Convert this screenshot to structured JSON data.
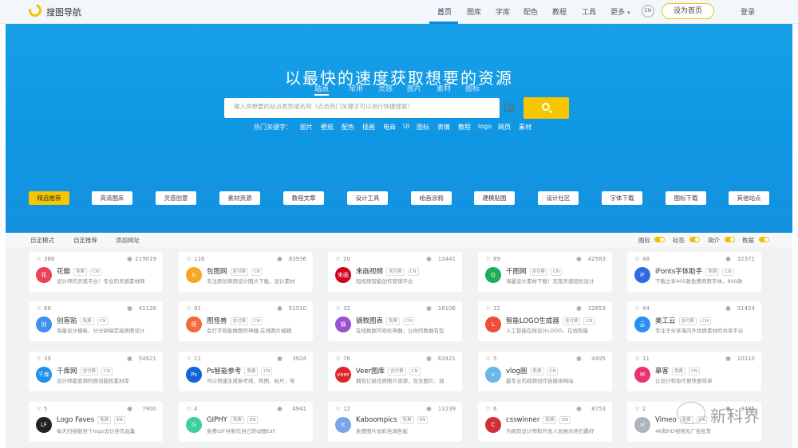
{
  "nav": {
    "logo": "搜图导航",
    "items": [
      "首页",
      "图库",
      "字库",
      "配色",
      "教程",
      "工具",
      "更多"
    ],
    "lang": "EN",
    "set_home": "设为首页",
    "login": "登录"
  },
  "hero": {
    "title": "以最快的速度获取想要的资源",
    "search_tabs": [
      "站点",
      "常用",
      "灵感",
      "图片",
      "素材",
      "图标"
    ],
    "search_placeholder": "输入你想要的站点类型或名称（点击热门关键字可以进行快捷搜索）",
    "hot_label": "热门关键字：",
    "hot_keywords": [
      "图片",
      "壁纸",
      "配色",
      "插画",
      "电商",
      "UI",
      "图标",
      "表情",
      "教程",
      "logo",
      "网页",
      "素材"
    ]
  },
  "categories": [
    "精选推荐",
    "高清图库",
    "灵感创意",
    "素材资源",
    "教程文章",
    "设计工具",
    "绘画涂鸦",
    "建模贴图",
    "设计社区",
    "字体下载",
    "图标下载",
    "其他站点"
  ],
  "filters": {
    "left": [
      "自定模式",
      "自定推荐",
      "添加网址"
    ],
    "toggles": [
      "图标",
      "标签",
      "简介",
      "数据"
    ]
  },
  "tags": {
    "free": "免费",
    "trial": "含付费",
    "cn": "CN",
    "en": "EN"
  },
  "cards": [
    {
      "likes": "366",
      "views": "219019",
      "name": "花瓣",
      "desc": "设计师的灵感平台！专业的灵感素材网",
      "tags": [
        "免费",
        "CN"
      ],
      "color": "#e9435a",
      "icon_text": "花"
    },
    {
      "likes": "116",
      "views": "83936",
      "name": "包图网",
      "desc": "专注原创商用设计图片下载，设计素材",
      "tags": [
        "含付费",
        "CN"
      ],
      "color": "#f5a623",
      "icon_text": "b"
    },
    {
      "likes": "20",
      "views": "13441",
      "name": "来画视频",
      "desc": "短视频智能创作营销平台",
      "tags": [
        "含付费",
        "CN"
      ],
      "color": "#d0021b",
      "icon_text": "来画"
    },
    {
      "likes": "89",
      "views": "42583",
      "name": "千图网",
      "desc": "海量设计素材下载！无限灵感轻松设计",
      "tags": [
        "含付费",
        "CN"
      ],
      "color": "#1aae5a",
      "icon_text": "Q"
    },
    {
      "likes": "48",
      "views": "32371",
      "name": "iFonts字体助手",
      "desc": "下载立享405款免费商用字体，800款",
      "tags": [
        "免费",
        "CN"
      ],
      "color": "#2f6be0",
      "icon_text": "iF"
    },
    {
      "likes": "68",
      "views": "41126",
      "name": "创客贴",
      "desc": "海量设计模板，分分钟搞定高质图设计",
      "tags": [
        "免费",
        "CN"
      ],
      "color": "#3d8ff3",
      "icon_text": "创"
    },
    {
      "likes": "91",
      "views": "51510",
      "name": "图怪兽",
      "desc": "会打字就能做图的神器,在线图片编辑",
      "tags": [
        "含付费",
        "CN"
      ],
      "color": "#f06a3b",
      "icon_text": "怪"
    },
    {
      "likes": "32",
      "views": "16106",
      "name": "镝数图表",
      "desc": "在线数据可视化神器，让你的数据有型",
      "tags": [
        "免费",
        "CN"
      ],
      "color": "#9b4fd3",
      "icon_text": "镝"
    },
    {
      "likes": "12",
      "views": "12853",
      "name": "智能LOGO生成器",
      "desc": "人工智能在线设计LOGO，在线智能",
      "tags": [
        "含付费",
        "CN"
      ],
      "color": "#f04d3a",
      "icon_text": "L"
    },
    {
      "likes": "44",
      "views": "31424",
      "name": "美工云",
      "desc": "专注于分享海内外优质素材的共享平台",
      "tags": [
        "含付费",
        "CN"
      ],
      "color": "#2a8ff0",
      "icon_text": "云"
    },
    {
      "likes": "39",
      "views": "54921",
      "name": "千库网",
      "desc": "设计师都爱用的原创版权素材库",
      "tags": [
        "含付费",
        "CN"
      ],
      "color": "#1f8fe8",
      "icon_text": "千库"
    },
    {
      "likes": "11",
      "views": "3924",
      "name": "Ps智能参考",
      "desc": "可以快速生成参考线、构图、标尺，帮",
      "tags": [
        "免费",
        "CN"
      ],
      "color": "#1464d8",
      "icon_text": "Ps"
    },
    {
      "likes": "76",
      "views": "63421",
      "name": "Veer图库",
      "desc": "拥有亿级优质图片资源，包含图片、插",
      "tags": [
        "含付费",
        "CN"
      ],
      "color": "#e0242b",
      "icon_text": "veer"
    },
    {
      "likes": "5",
      "views": "4495",
      "name": "vlog圈",
      "desc": "最专业的视频创作自媒体网站",
      "tags": [
        "免费",
        "CN"
      ],
      "color": "#6cb6e8",
      "icon_text": "v"
    },
    {
      "likes": "11",
      "views": "10310",
      "name": "摹客",
      "desc": "让设计和协作更快更简单",
      "tags": [
        "免费",
        "CN"
      ],
      "color": "#e8336d",
      "icon_text": "M"
    },
    {
      "likes": "5",
      "views": "7900",
      "name": "Logo Faves",
      "desc": "每天扫描数百个logo设计佳作品集",
      "tags": [
        "免费",
        "EN"
      ],
      "color": "#222222",
      "icon_text": "LF"
    },
    {
      "likes": "4",
      "views": "4941",
      "name": "GIPHY",
      "desc": "免费GIF并制作自己的动图GIF",
      "tags": [
        "免费",
        "EN"
      ],
      "color": "#3ecf9a",
      "icon_text": "G"
    },
    {
      "likes": "12",
      "views": "13239",
      "name": "Kaboompics",
      "desc": "免费图片加彩色调色板",
      "tags": [
        "免费",
        "EN"
      ],
      "color": "#7aa4e8",
      "icon_text": "K"
    },
    {
      "likes": "6",
      "views": "8753",
      "name": "csswinner",
      "desc": "为网页设计师和开发人员展示他们最好",
      "tags": [
        "免费",
        "EN"
      ],
      "color": "#d0303a",
      "icon_text": "C"
    },
    {
      "likes": "2",
      "views": "9495",
      "name": "Vimeo",
      "desc": "4K和HD视频无广告批贺",
      "tags": [
        "免费",
        "EN"
      ],
      "color": "#aeb4bb",
      "icon_text": "vi"
    }
  ],
  "watermark": "新科界"
}
